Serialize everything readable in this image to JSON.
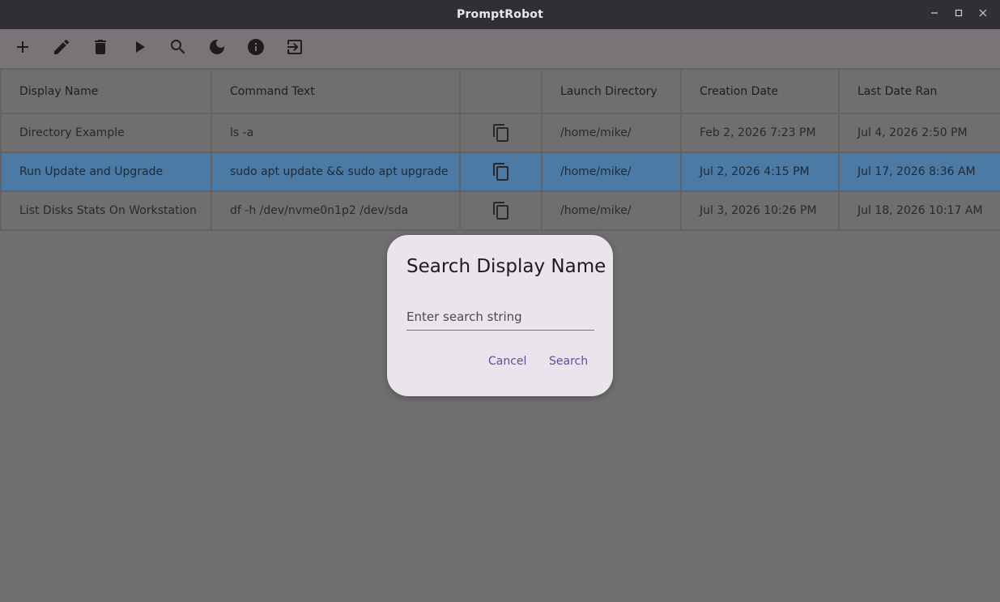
{
  "window": {
    "title": "PromptRobot",
    "controls": [
      "minimize-icon",
      "maximize-icon",
      "close-icon"
    ]
  },
  "toolbar": {
    "icons": [
      "add-icon",
      "edit-icon",
      "delete-icon",
      "run-icon",
      "search-icon",
      "dark-mode-icon",
      "info-icon",
      "exit-icon"
    ]
  },
  "table": {
    "headers": [
      "Display Name",
      "Command Text",
      "",
      "Launch Directory",
      "Creation Date",
      "Last Date Ran"
    ],
    "rows": [
      {
        "display_name": "Directory Example",
        "command_text": "ls -a",
        "launch_directory": "/home/mike/",
        "creation_date": "Feb 2, 2026 7:23 PM",
        "last_date_ran": "Jul 4, 2026 2:50 PM",
        "selected": false
      },
      {
        "display_name": "Run Update and Upgrade",
        "command_text": "sudo apt update && sudo apt upgrade",
        "launch_directory": "/home/mike/",
        "creation_date": "Jul 2, 2026 4:15 PM",
        "last_date_ran": "Jul 17, 2026 8:36 AM",
        "selected": true
      },
      {
        "display_name": "List Disks Stats On Workstation",
        "command_text": "df -h /dev/nvme0n1p2 /dev/sda",
        "launch_directory": "/home/mike/",
        "creation_date": "Jul 3, 2026 10:26 PM",
        "last_date_ran": "Jul 18, 2026 10:17 AM",
        "selected": false
      }
    ]
  },
  "dialog": {
    "title": "Search Display Name",
    "input_value": "",
    "input_placeholder": "Enter search string",
    "cancel_label": "Cancel",
    "search_label": "Search"
  },
  "colors": {
    "titlebar": "#2f3033",
    "toolbar": "#7a7479",
    "selected_row": "#4b7aa5",
    "dialog_bg": "#ebe4ed",
    "dialog_action": "#5b4f9c"
  }
}
